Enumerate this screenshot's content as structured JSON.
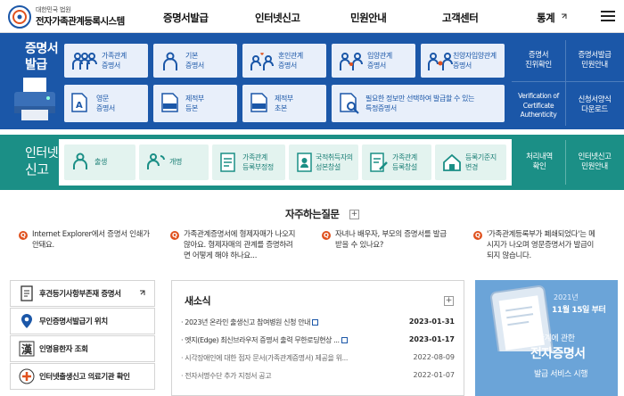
{
  "header": {
    "org": "대한민국 법원",
    "title": "전자가족관계등록시스템",
    "nav": [
      "증명서발급",
      "인터넷신고",
      "민원안내",
      "고객센터",
      "통계"
    ]
  },
  "issue": {
    "label": [
      "증명서",
      "발급"
    ],
    "cards": [
      [
        "가족관계",
        "증명서"
      ],
      [
        "기본",
        "증명서"
      ],
      [
        "혼인관계",
        "증명서"
      ],
      [
        "입양관계",
        "증명서"
      ],
      [
        "친양자입양관계",
        "증명서"
      ],
      [
        "영문",
        "증명서"
      ],
      [
        "제적부",
        "등본"
      ],
      [
        "제적부",
        "초본"
      ],
      [
        "필요한 정보만 선택하여 발급할 수 있는",
        "특정증명서"
      ]
    ],
    "side": [
      [
        "증명서",
        "진위확인"
      ],
      [
        "증명서발급",
        "민원안내"
      ],
      [
        "Verification of",
        "Certificate",
        "Authenticity"
      ],
      [
        "신청서양식",
        "다운로드"
      ]
    ]
  },
  "report": {
    "label": [
      "인터넷",
      "신고"
    ],
    "cards": [
      [
        "출생"
      ],
      [
        "개명"
      ],
      [
        "가족관계",
        "등록부정정"
      ],
      [
        "국적취득자의",
        "성본창설"
      ],
      [
        "가족관계",
        "등록창설"
      ],
      [
        "등록기준지",
        "변경"
      ]
    ],
    "side": [
      [
        "처리내역",
        "확인"
      ],
      [
        "인터넷신고",
        "민원안내"
      ]
    ]
  },
  "faq": {
    "title": "자주하는질문",
    "items": [
      [
        "Internet Explorer에서 증명서 인쇄가",
        "안돼요."
      ],
      [
        "가족관계증명서에 형제자매가 나오지",
        "않아요. 형제자매의 관계를 증명하려",
        "면 어떻게 해야 하나요..."
      ],
      [
        "자녀나 배우자, 부모의 증명서를 발급",
        "받을 수 있나요?"
      ],
      [
        "'가족관계등록부가 폐쇄되었다'는 메",
        "시지가 나오며 영문증명서가 발급이",
        "되지 않습니다."
      ]
    ]
  },
  "quick": [
    "후견등기사항부존재 증명서",
    "무인증명서발급기 위치",
    "인명용한자 조회",
    "인터넷출생신고 의료기관 확인"
  ],
  "news": {
    "title": "새소식",
    "items": [
      {
        "t": "2023년 온라인 출생신고 참여병원 신청 안내",
        "d": "2023-01-31",
        "bold": true
      },
      {
        "t": "엣지(Edge) 최신브라우저 증명서 출력 무한로딩현상 ...",
        "d": "2023-01-17",
        "bold": true
      },
      {
        "t": "시각장애인에 대한 점자 문서(가족관계증명서) 제공을 위...",
        "d": "2022-08-09",
        "bold": false
      },
      {
        "t": "전자서명수단 추가 지정서 공고",
        "d": "2022-01-07",
        "bold": false
      }
    ]
  },
  "banner": {
    "year": "2021년",
    "date": "11월 15일 부터",
    "line1": "가족관계에 관한",
    "line2": "전자증명서",
    "line3": "발급 서비스 시행"
  }
}
